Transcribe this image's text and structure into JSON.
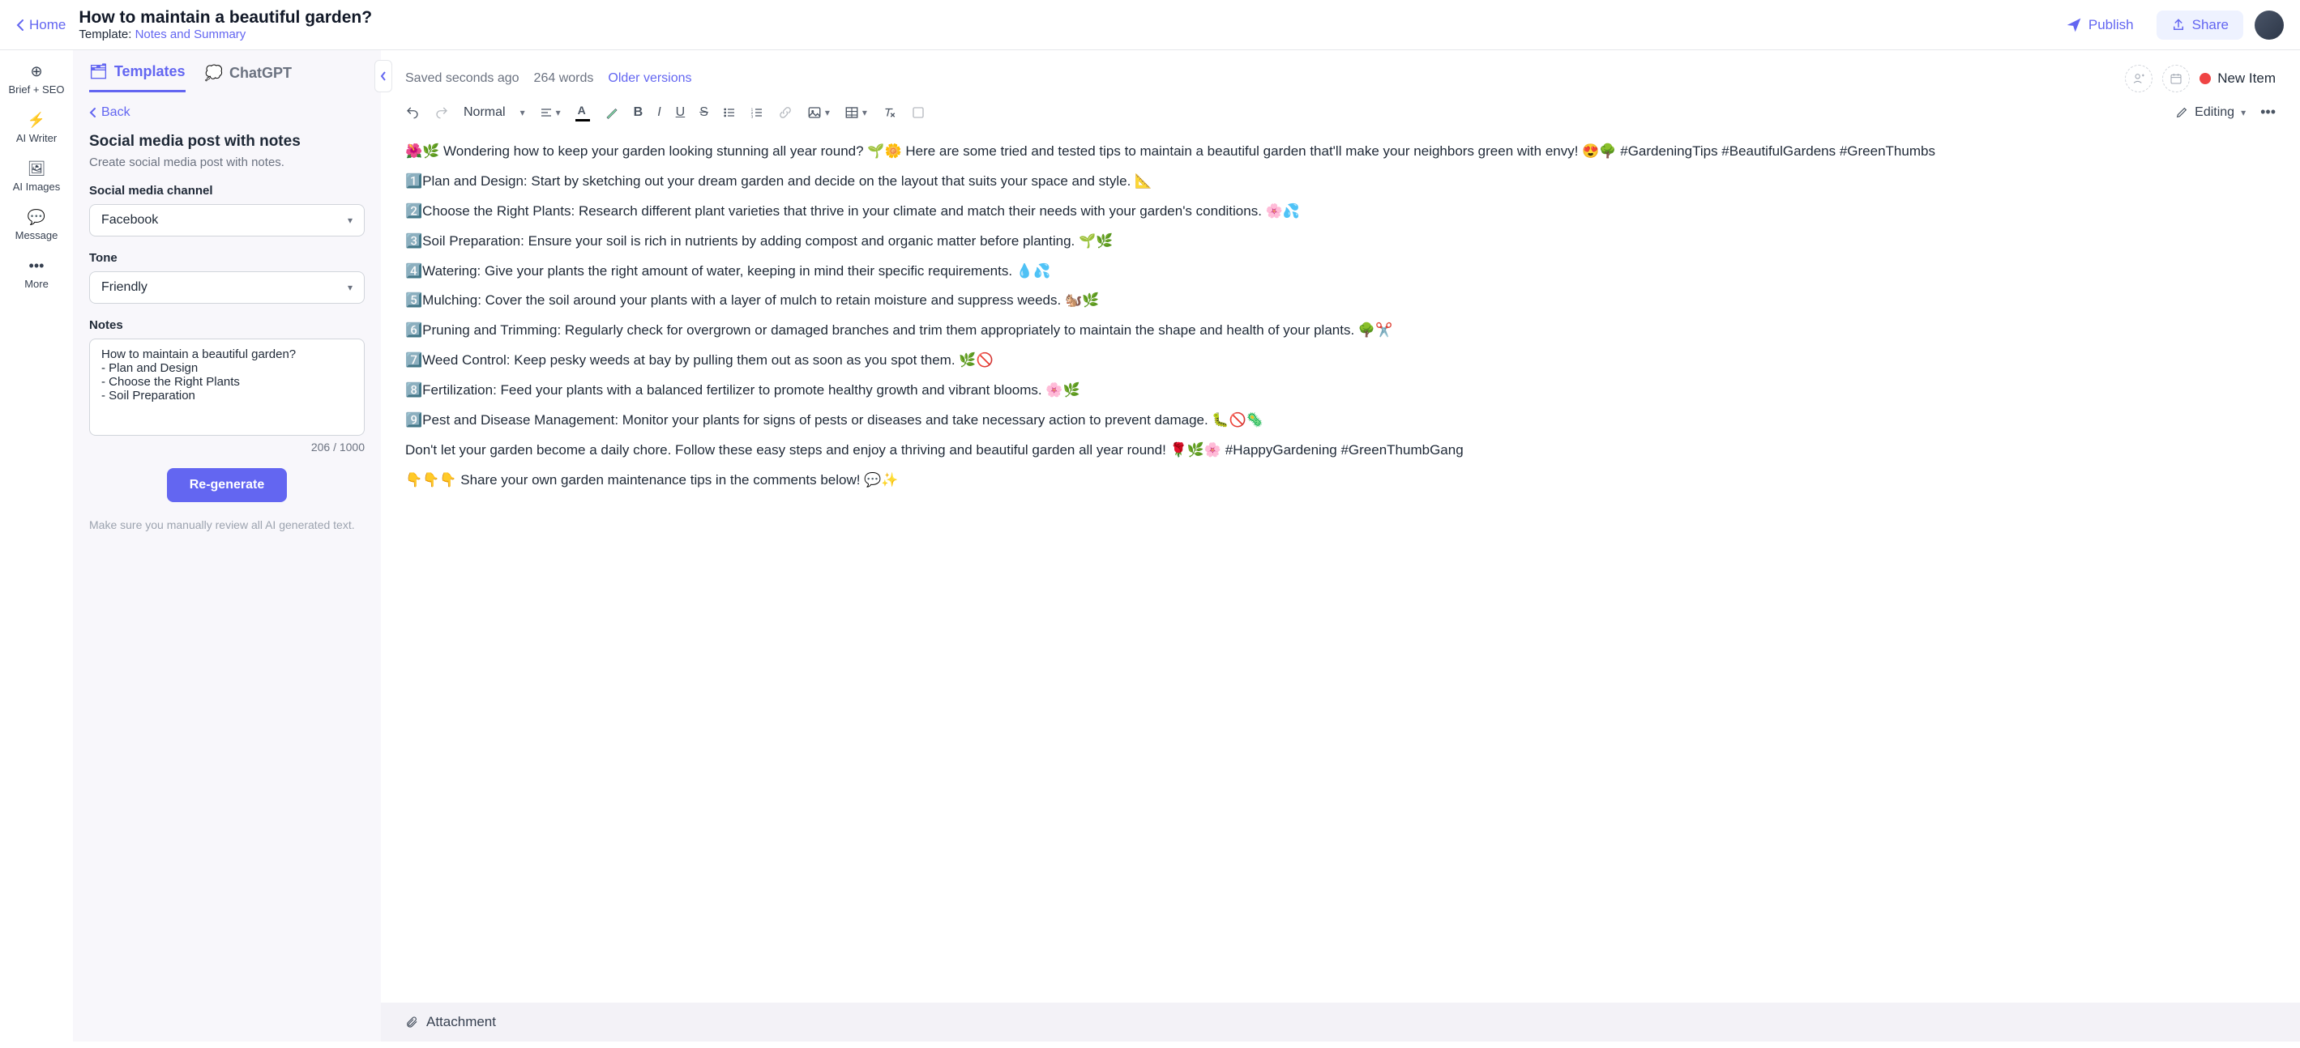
{
  "header": {
    "home": "Home",
    "title": "How to maintain a beautiful garden?",
    "template_prefix": "Template: ",
    "template_name": "Notes and Summary",
    "publish": "Publish",
    "share": "Share"
  },
  "nav": {
    "brief": "Brief + SEO",
    "writer": "AI Writer",
    "images": "AI Images",
    "message": "Message",
    "more": "More"
  },
  "panel": {
    "tab_templates": "Templates",
    "tab_chatgpt": "ChatGPT",
    "back": "Back",
    "title": "Social media post with notes",
    "subtitle": "Create social media post with notes.",
    "channel_label": "Social media channel",
    "channel_value": "Facebook",
    "tone_label": "Tone",
    "tone_value": "Friendly",
    "notes_label": "Notes",
    "notes_value": "How to maintain a beautiful garden?\n- Plan and Design\n- Choose the Right Plants\n- Soil Preparation",
    "counter": "206 / 1000",
    "regenerate": "Re-generate",
    "disclaimer": "Make sure you manually review all AI generated text."
  },
  "meta": {
    "saved": "Saved seconds ago",
    "words": "264 words",
    "older": "Older versions",
    "new_item": "New Item"
  },
  "toolbar": {
    "style": "Normal",
    "editing": "Editing"
  },
  "content": {
    "p1": "🌺🌿 Wondering how to keep your garden looking stunning all year round? 🌱🌼 Here are some tried and tested tips to maintain a beautiful garden that'll make your neighbors green with envy! 😍🌳 #GardeningTips #BeautifulGardens #GreenThumbs",
    "p2": "1️⃣Plan and Design: Start by sketching out your dream garden and decide on the layout that suits your space and style. 📐",
    "p3": "2️⃣Choose the Right Plants: Research different plant varieties that thrive in your climate and match their needs with your garden's conditions. 🌸💦",
    "p4": "3️⃣Soil Preparation: Ensure your soil is rich in nutrients by adding compost and organic matter before planting. 🌱🌿",
    "p5": "4️⃣Watering: Give your plants the right amount of water, keeping in mind their specific requirements. 💧💦",
    "p6": "5️⃣Mulching: Cover the soil around your plants with a layer of mulch to retain moisture and suppress weeds. 🐿️🌿",
    "p7": "6️⃣Pruning and Trimming: Regularly check for overgrown or damaged branches and trim them appropriately to maintain the shape and health of your plants. 🌳✂️",
    "p8": "7️⃣Weed Control: Keep pesky weeds at bay by pulling them out as soon as you spot them. 🌿🚫",
    "p9": "8️⃣Fertilization: Feed your plants with a balanced fertilizer to promote healthy growth and vibrant blooms. 🌸🌿",
    "p10": "9️⃣Pest and Disease Management: Monitor your plants for signs of pests or diseases and take necessary action to prevent damage. 🐛🚫🦠",
    "p11": "Don't let your garden become a daily chore. Follow these easy steps and enjoy a thriving and beautiful garden all year round! 🌹🌿🌸 #HappyGardening #GreenThumbGang",
    "p12": "👇👇👇 Share your own garden maintenance tips in the comments below! 💬✨"
  },
  "attachment": "Attachment"
}
